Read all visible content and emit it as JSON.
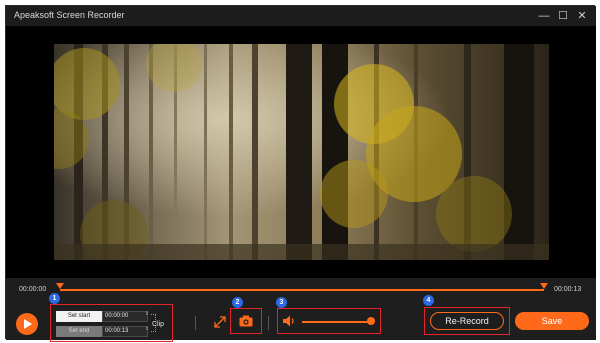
{
  "window": {
    "title": "Apeaksoft Screen Recorder",
    "controls": {
      "minimize": "—",
      "maximize": "☐",
      "close": "✕"
    }
  },
  "timeline": {
    "start_time": "00:00:00",
    "end_time": "00:00:13"
  },
  "clip": {
    "set_start_label": "Set start",
    "set_end_label": "Set end",
    "start_value": "00:00:00",
    "end_value": "00:00:13",
    "label": "Clip"
  },
  "annotations": [
    "1",
    "2",
    "3",
    "4"
  ],
  "volume": {
    "level": 1.0
  },
  "buttons": {
    "rerecord_label": "Re-Record",
    "save_label": "Save"
  },
  "colors": {
    "accent": "#ff6a1a",
    "highlight_box": "#e3252b",
    "badge": "#2b68e6",
    "background": "#1e1e1e"
  },
  "icons": [
    "play-icon",
    "expand-icon",
    "camera-icon",
    "speaker-icon",
    "spinner-up-icon",
    "spinner-down-icon"
  ]
}
